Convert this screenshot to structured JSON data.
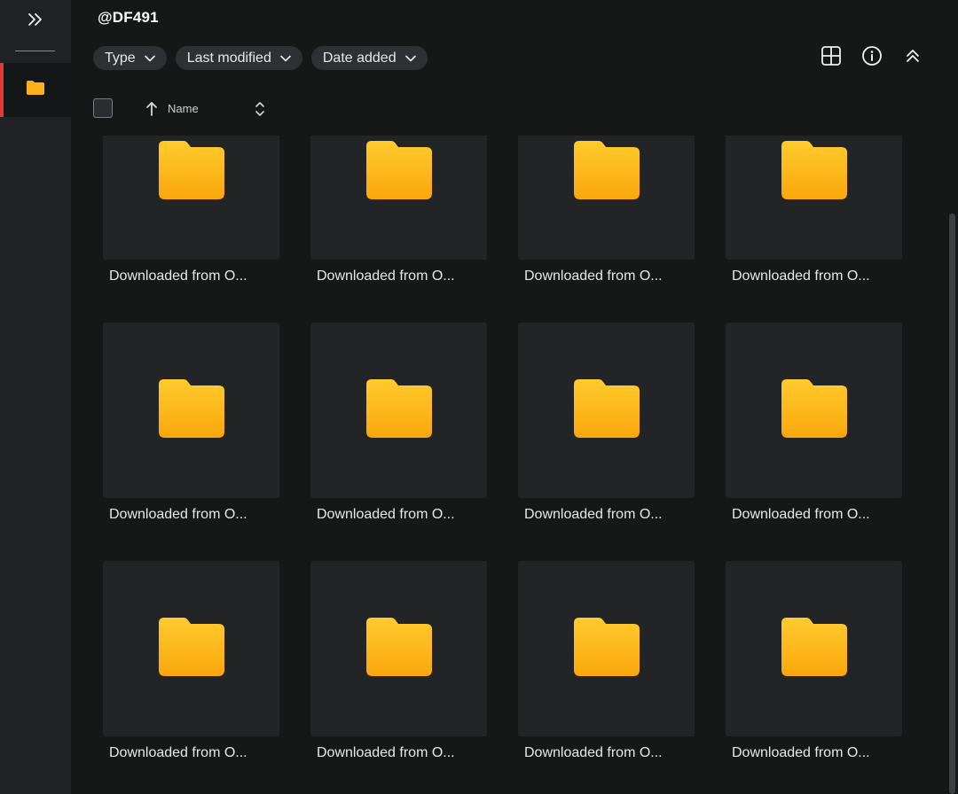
{
  "header": {
    "title": "@DF491"
  },
  "filters": [
    {
      "label": "Type"
    },
    {
      "label": "Last modified"
    },
    {
      "label": "Date added"
    }
  ],
  "columns": {
    "name_label": "Name"
  },
  "sidebar": {
    "active_item": "folders",
    "accent_color": "#e53935"
  },
  "colors": {
    "folder": "#fbb018",
    "background": "#161818",
    "tile": "#232426"
  },
  "items": [
    {
      "name": "Downloaded from O..."
    },
    {
      "name": "Downloaded from O..."
    },
    {
      "name": "Downloaded from O..."
    },
    {
      "name": "Downloaded from O..."
    },
    {
      "name": "Downloaded from O..."
    },
    {
      "name": "Downloaded from O..."
    },
    {
      "name": "Downloaded from O..."
    },
    {
      "name": "Downloaded from O..."
    },
    {
      "name": "Downloaded from O..."
    },
    {
      "name": "Downloaded from O..."
    },
    {
      "name": "Downloaded from O..."
    },
    {
      "name": "Downloaded from O..."
    }
  ]
}
